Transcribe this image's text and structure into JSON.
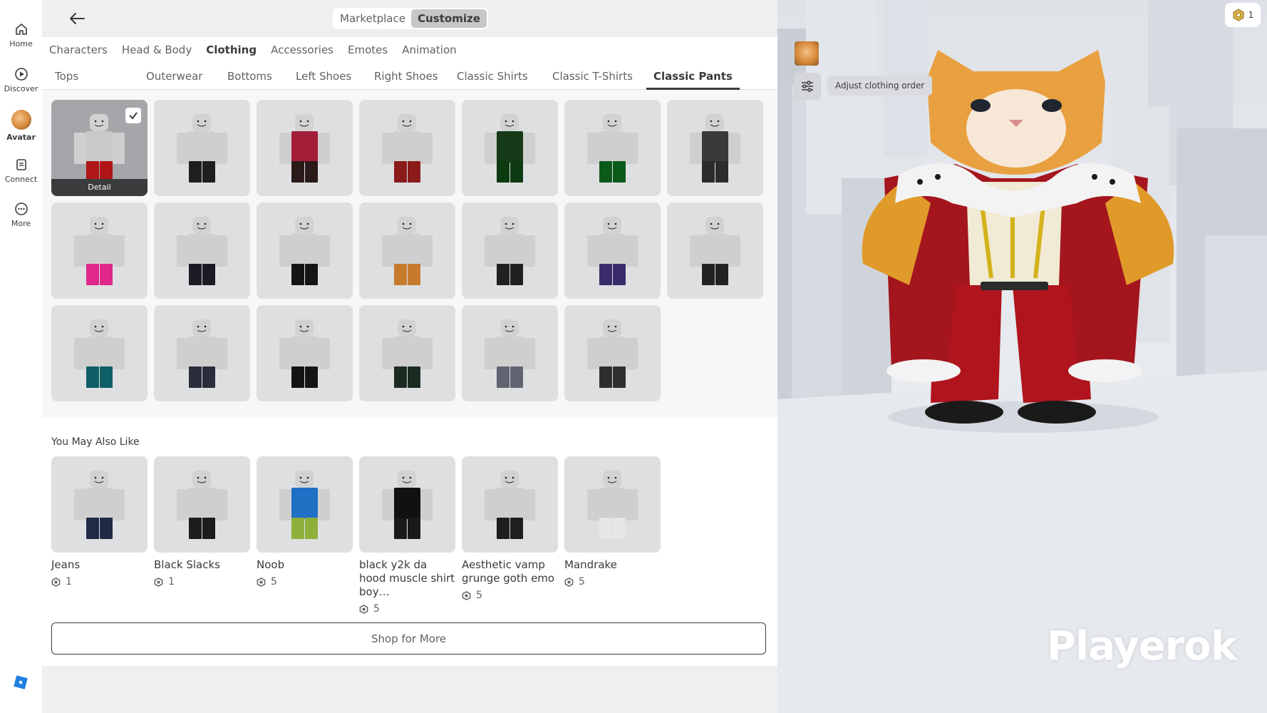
{
  "nav": {
    "items": [
      {
        "label": "Home",
        "icon": "home-icon"
      },
      {
        "label": "Discover",
        "icon": "discover-icon"
      },
      {
        "label": "Avatar",
        "icon": "avatar-icon"
      },
      {
        "label": "Connect",
        "icon": "connect-icon"
      },
      {
        "label": "More",
        "icon": "more-icon"
      }
    ],
    "active": "Avatar"
  },
  "header": {
    "segments": [
      "Marketplace",
      "Customize"
    ],
    "active_segment": "Customize"
  },
  "categories": [
    "Characters",
    "Head & Body",
    "Clothing",
    "Accessories",
    "Emotes",
    "Animation"
  ],
  "active_category": "Clothing",
  "subcategories": [
    "Tops",
    "Outerwear",
    "Bottoms",
    "Left Shoes",
    "Right Shoes",
    "Classic Shirts",
    "Classic T-Shirts",
    "Classic Pants"
  ],
  "active_subcategory": "Classic Pants",
  "inventory": {
    "selected_index": 0,
    "detail_label": "Detail",
    "items": [
      {
        "pants": "#b01616",
        "torso": "#c9c9c9"
      },
      {
        "pants": "#1e1e1e",
        "torso": "#cfcfcf"
      },
      {
        "pants": "#2a1a1a",
        "torso": "#a31f3a"
      },
      {
        "pants": "#8b1a1a",
        "torso": "#cfcfcf"
      },
      {
        "pants": "#0e3a12",
        "torso": "#163a18"
      },
      {
        "pants": "#0b5a1a",
        "torso": "#cfcfcf"
      },
      {
        "pants": "#2b2b2b",
        "torso": "#3a3a3a"
      },
      {
        "pants": "#e0288a",
        "torso": "#cfcfcf"
      },
      {
        "pants": "#1b1b24",
        "torso": "#cfcfcf"
      },
      {
        "pants": "#151515",
        "torso": "#cfcfcf"
      },
      {
        "pants": "#c67a2c",
        "torso": "#cfcfcf"
      },
      {
        "pants": "#202020",
        "torso": "#cfcfcf"
      },
      {
        "pants": "#3a2b6a",
        "torso": "#cfcfcf"
      },
      {
        "pants": "#222222",
        "torso": "#cfcfcf"
      },
      {
        "pants": "#0e5e66",
        "torso": "#cfcfcf"
      },
      {
        "pants": "#2a2d3a",
        "torso": "#cfcfcf"
      },
      {
        "pants": "#141414",
        "torso": "#cfcfcf"
      },
      {
        "pants": "#1c2b22",
        "torso": "#cfcfcf"
      },
      {
        "pants": "#5f6470",
        "torso": "#cfcfcf"
      },
      {
        "pants": "#2f2f2f",
        "torso": "#cfcfcf"
      }
    ]
  },
  "recommendations": {
    "title": "You May Also Like",
    "items": [
      {
        "name": "Jeans",
        "price": "1",
        "pants": "#1f2a44",
        "torso": "#cfcfcf"
      },
      {
        "name": "Black Slacks",
        "price": "1",
        "pants": "#1c1c1c",
        "torso": "#cfcfcf"
      },
      {
        "name": "Noob",
        "price": "5",
        "pants": "#8fb03a",
        "torso": "#1f6fc4"
      },
      {
        "name": "black y2k da hood muscle shirt boy…",
        "price": "5",
        "pants": "#1a1a1a",
        "torso": "#111111"
      },
      {
        "name": "Aesthetic vamp grunge goth emo",
        "price": "5",
        "pants": "#1e1e1e",
        "torso": "#cfcfcf"
      },
      {
        "name": "Mandrake",
        "price": "5",
        "pants": "#e6e6e6",
        "torso": "#cfcfcf"
      }
    ],
    "shop_label": "Shop for More"
  },
  "preview": {
    "tooltip": "Adjust clothing order",
    "robux_count": "1",
    "watermark": "Playerok"
  },
  "colors": {
    "accent": "#393b3d",
    "tile": "#dedfe1",
    "selected_tile": "#a4a6a9",
    "roblox_blue": "#1f7fe0"
  }
}
